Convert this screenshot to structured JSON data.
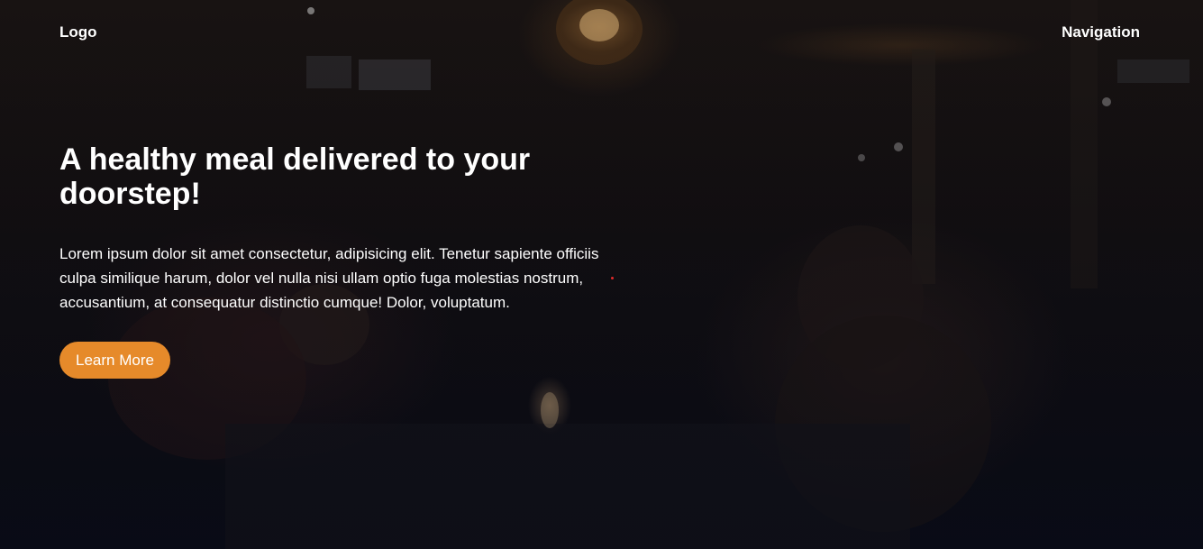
{
  "header": {
    "logo_label": "Logo",
    "nav_label": "Navigation"
  },
  "hero": {
    "headline": "A healthy meal delivered to your doorstep!",
    "description": "Lorem ipsum dolor sit amet consectetur, adipisicing elit. Tenetur sapiente officiis culpa similique harum, dolor vel nulla nisi ullam optio fuga molestias nostrum, accusantium, at consequatur distinctio cumque! Dolor, voluptatum.",
    "cta_label": "Learn More"
  },
  "colors": {
    "accent": "#e68a2a",
    "text": "#ffffff",
    "background": "#0d0c10"
  }
}
